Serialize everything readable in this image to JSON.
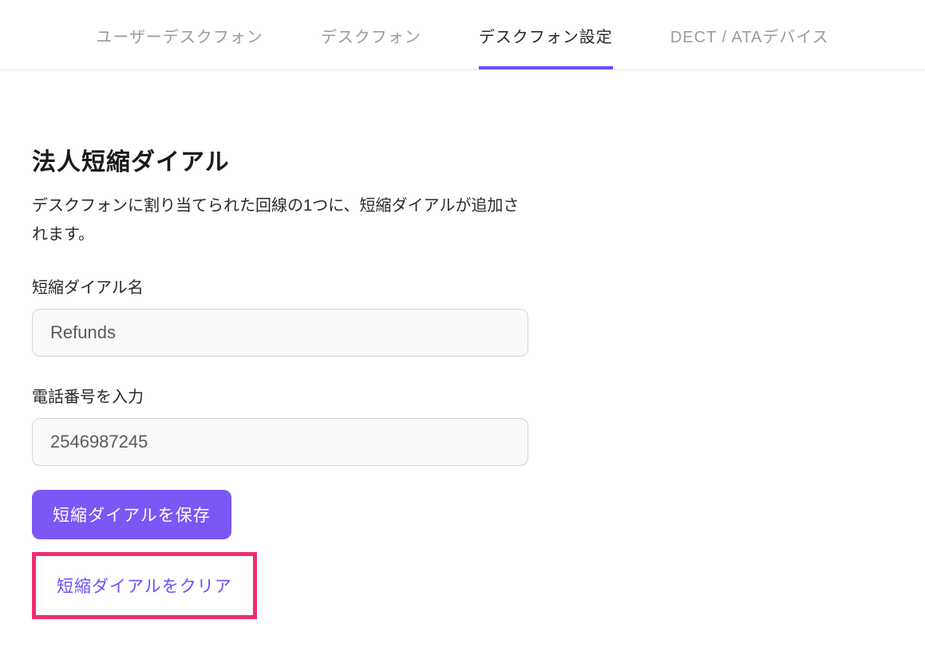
{
  "tabs": [
    {
      "label": "ユーザーデスクフォン",
      "active": false
    },
    {
      "label": "デスクフォン",
      "active": false
    },
    {
      "label": "デスクフォン設定",
      "active": true
    },
    {
      "label": "DECT / ATAデバイス",
      "active": false
    }
  ],
  "section": {
    "title": "法人短縮ダイアル",
    "description": "デスクフォンに割り当てられた回線の1つに、短縮ダイアルが追加されます。"
  },
  "fields": {
    "name_label": "短縮ダイアル名",
    "name_value": "Refunds",
    "phone_label": "電話番号を入力",
    "phone_value": "2546987245"
  },
  "buttons": {
    "save_label": "短縮ダイアルを保存",
    "clear_label": "短縮ダイアルをクリア"
  }
}
